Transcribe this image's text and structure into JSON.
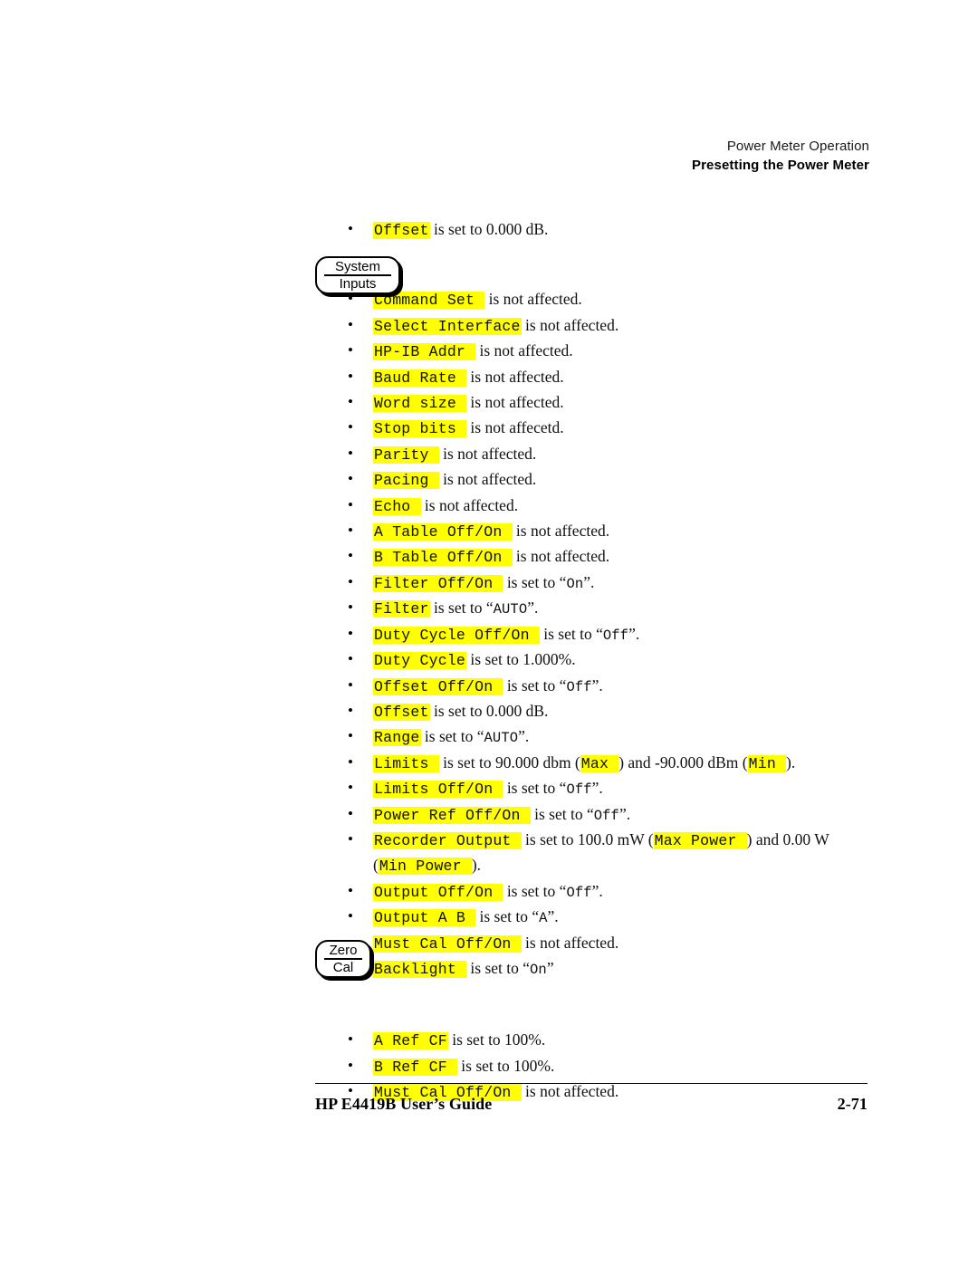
{
  "header": {
    "line1": "Power Meter Operation",
    "line2": "Presetting the Power Meter"
  },
  "keys": {
    "system_inputs": {
      "top": "System",
      "bottom": "Inputs"
    },
    "zero_cal": {
      "top": "Zero",
      "bottom": "Cal"
    }
  },
  "colors": {
    "highlight": "#ffff00",
    "text": "#000000",
    "page_background": "#ffffff"
  },
  "lead_bullet": {
    "label": "Offset",
    "text": " is set to 0.000 dB."
  },
  "system_inputs_bullets": [
    {
      "label": "Command Set ",
      "parts": [
        {
          "t": "plain",
          "v": " is not affected."
        }
      ]
    },
    {
      "label": "Select Interface",
      "parts": [
        {
          "t": "plain",
          "v": " is not affected."
        }
      ]
    },
    {
      "label": "HP-IB Addr ",
      "parts": [
        {
          "t": "plain",
          "v": " is not affected."
        }
      ]
    },
    {
      "label": "Baud Rate ",
      "parts": [
        {
          "t": "plain",
          "v": " is not affected."
        }
      ]
    },
    {
      "label": "Word size ",
      "parts": [
        {
          "t": "plain",
          "v": " is not affected."
        }
      ]
    },
    {
      "label": "Stop bits ",
      "parts": [
        {
          "t": "plain",
          "v": " is not affecetd."
        }
      ]
    },
    {
      "label": "Parity ",
      "parts": [
        {
          "t": "plain",
          "v": " is not affected."
        }
      ]
    },
    {
      "label": "Pacing ",
      "parts": [
        {
          "t": "plain",
          "v": " is not affected."
        }
      ]
    },
    {
      "label": "Echo ",
      "parts": [
        {
          "t": "plain",
          "v": " is not affected."
        }
      ]
    },
    {
      "label": "A Table Off/On ",
      "parts": [
        {
          "t": "plain",
          "v": " is not affected."
        }
      ]
    },
    {
      "label": "B Table Off/On ",
      "parts": [
        {
          "t": "plain",
          "v": " is not affected."
        }
      ]
    },
    {
      "label": "Filter Off/On ",
      "parts": [
        {
          "t": "plain",
          "v": " is set to “"
        },
        {
          "t": "mono",
          "v": "On"
        },
        {
          "t": "plain",
          "v": "”."
        }
      ]
    },
    {
      "label": "Filter",
      "parts": [
        {
          "t": "plain",
          "v": " is set to “"
        },
        {
          "t": "mono",
          "v": "AUTO"
        },
        {
          "t": "plain",
          "v": "”."
        }
      ]
    },
    {
      "label": "Duty Cycle Off/On ",
      "parts": [
        {
          "t": "plain",
          "v": " is set to “"
        },
        {
          "t": "mono",
          "v": "Off"
        },
        {
          "t": "plain",
          "v": "”."
        }
      ]
    },
    {
      "label": "Duty Cycle",
      "parts": [
        {
          "t": "plain",
          "v": " is set to 1.000%."
        }
      ]
    },
    {
      "label": "Offset Off/On ",
      "parts": [
        {
          "t": "plain",
          "v": " is set to “"
        },
        {
          "t": "mono",
          "v": "Off"
        },
        {
          "t": "plain",
          "v": "”."
        }
      ]
    },
    {
      "label": "Offset",
      "parts": [
        {
          "t": "plain",
          "v": " is set to 0.000 dB."
        }
      ]
    },
    {
      "label": "Range",
      "parts": [
        {
          "t": "plain",
          "v": " is set to “"
        },
        {
          "t": "mono",
          "v": "AUTO"
        },
        {
          "t": "plain",
          "v": "”."
        }
      ]
    },
    {
      "label": "Limits ",
      "parts": [
        {
          "t": "plain",
          "v": " is set to 90.000 dbm ("
        },
        {
          "t": "hl",
          "v": "Max "
        },
        {
          "t": "plain",
          "v": ") and -90.000 dBm ("
        },
        {
          "t": "hl",
          "v": "Min "
        },
        {
          "t": "plain",
          "v": ")."
        }
      ]
    },
    {
      "label": "Limits Off/On ",
      "parts": [
        {
          "t": "plain",
          "v": " is set to “"
        },
        {
          "t": "mono",
          "v": "Off"
        },
        {
          "t": "plain",
          "v": "”."
        }
      ]
    },
    {
      "label": "Power Ref Off/On ",
      "parts": [
        {
          "t": "plain",
          "v": " is set to “"
        },
        {
          "t": "mono",
          "v": "Off"
        },
        {
          "t": "plain",
          "v": "”."
        }
      ]
    },
    {
      "label": "Recorder Output ",
      "parts": [
        {
          "t": "plain",
          "v": " is set to 100.0 mW ("
        },
        {
          "t": "hl",
          "v": "Max Power "
        },
        {
          "t": "plain",
          "v": ") and 0.00 W ("
        },
        {
          "t": "hl",
          "v": "Min Power "
        },
        {
          "t": "plain",
          "v": ")."
        }
      ]
    },
    {
      "label": "Output Off/On ",
      "parts": [
        {
          "t": "plain",
          "v": " is set to “"
        },
        {
          "t": "mono",
          "v": "Off"
        },
        {
          "t": "plain",
          "v": "”."
        }
      ]
    },
    {
      "label": "Output A B ",
      "parts": [
        {
          "t": "plain",
          "v": " is set to “"
        },
        {
          "t": "mono",
          "v": "A"
        },
        {
          "t": "plain",
          "v": "”."
        }
      ]
    },
    {
      "label": "Must Cal Off/On ",
      "parts": [
        {
          "t": "plain",
          "v": " is not affected."
        }
      ]
    },
    {
      "label": "Backlight ",
      "parts": [
        {
          "t": "plain",
          "v": " is set to “"
        },
        {
          "t": "mono",
          "v": "On"
        },
        {
          "t": "plain",
          "v": "”"
        }
      ]
    }
  ],
  "zero_cal_bullets": [
    {
      "label": "A Ref CF",
      "parts": [
        {
          "t": "plain",
          "v": " is set to 100%."
        }
      ]
    },
    {
      "label": "B Ref CF ",
      "parts": [
        {
          "t": "plain",
          "v": " is set to 100%."
        }
      ]
    },
    {
      "label": "Must Cal Off/On ",
      "parts": [
        {
          "t": "plain",
          "v": " is not affected."
        }
      ]
    }
  ],
  "footer": {
    "title": "HP E4419B User’s Guide",
    "page_number": "2-71"
  }
}
